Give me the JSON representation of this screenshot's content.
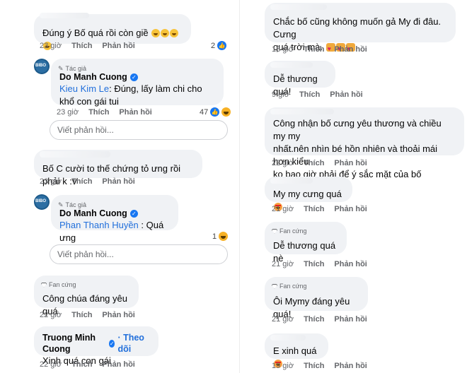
{
  "left": {
    "c1": {
      "text": "Đúng ý Bố quá rồi còn giề",
      "time": "23 giờ",
      "like": "Thích",
      "reply": "Phản hồi",
      "react_count": "2"
    },
    "c2": {
      "author_tag": "Tác giả",
      "author": "Do Manh Cuong",
      "mention": "Kieu Kim Le",
      "text": ": Đúng, lấy làm chi cho khổ con gái tui",
      "time": "23 giờ",
      "like": "Thích",
      "reply": "Phản hồi",
      "react_count": "47",
      "reply_placeholder": "Viết phản hồi..."
    },
    "c3": {
      "text": "Bố C cười to thế chứng tỏ ưng rồi phải k :v",
      "time": "23 giờ",
      "like": "Thích",
      "reply": "Phản hồi"
    },
    "c4": {
      "author_tag": "Tác giả",
      "author": "Do Manh Cuong",
      "mention": "Phan Thanh Huyền",
      "text": ": Quá ưng",
      "react_count": "1",
      "reply_placeholder": "Viết phản hồi..."
    },
    "c5": {
      "fan_tag": "Fan cứng",
      "text": "Công chúa đáng yêu quá",
      "time": "22 giờ",
      "like": "Thích",
      "reply": "Phản hồi"
    },
    "c6": {
      "author": "Truong Minh Cuong",
      "follow": "· Theo dõi",
      "text": "Xinh quá con gái",
      "time": "22 giờ",
      "like": "Thích",
      "reply": "Phản hồi"
    },
    "avatar_text": "BIBO"
  },
  "right": {
    "r1": {
      "line1": "Chắc bố cũng không muốn gả My đi đâu. Cưng",
      "line2": "quá trời mà.",
      "time": "18 giờ",
      "like": "Thích",
      "reply": "Phản hồi"
    },
    "r2": {
      "text": "Dễ thương quá!",
      "time": "9 giờ",
      "like": "Thích",
      "reply": "Phản hồi"
    },
    "r3": {
      "line1": "Công nhận bố cưng yêu thương và chiều my my",
      "line2": "nhất.nên nhìn bé hồn nhiên và thoải mái hơn kiểu",
      "line3": "ko bao giờ phải để ý sắc mặt của bố",
      "time": "22 giờ",
      "like": "Thích",
      "reply": "Phản hồi"
    },
    "r4": {
      "text": "My my cưng quá",
      "time": "21 giờ",
      "like": "Thích",
      "reply": "Phản hồi"
    },
    "r5": {
      "fan_tag": "Fan cứng",
      "text": "Dễ thương quá nè",
      "time": "21 giờ",
      "like": "Thích",
      "reply": "Phản hồi"
    },
    "r6": {
      "fan_tag": "Fan cứng",
      "text": "Ôi Mymy đáng yêu quá!",
      "time": "21 giờ",
      "like": "Thích",
      "reply": "Phản hồi"
    },
    "r7": {
      "text": "E xinh quá",
      "time": "19 giờ",
      "like": "Thích",
      "reply": "Phản hồi"
    }
  },
  "colors": {
    "bubble": "#f0f2f5",
    "link": "#216fdb",
    "verified": "#1877f2",
    "meta": "#65676b"
  },
  "icons": [
    "verified-badge-icon",
    "pencil-icon",
    "diamond-icon",
    "like-reaction-icon",
    "haha-reaction-icon",
    "grin-emoji-icon",
    "love-emoji-icon",
    "heart-eyes-emoji-icon"
  ]
}
